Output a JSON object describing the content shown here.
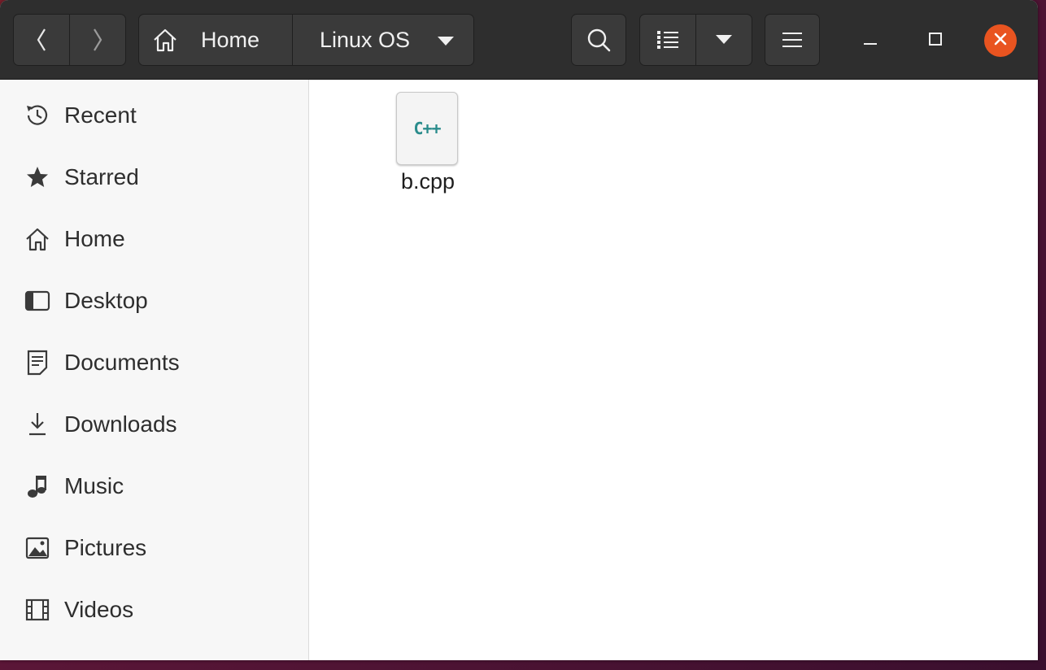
{
  "headerbar": {
    "breadcrumb": {
      "home_label": "Home",
      "current_label": "Linux OS"
    },
    "icons": {
      "back": "chevron-left-icon",
      "forward": "chevron-right-icon",
      "home": "home-icon",
      "search": "search-icon",
      "list_view": "list-view-icon",
      "view_menu": "chevron-down-icon",
      "main_menu": "hamburger-menu-icon",
      "minimize": "minimize-icon",
      "maximize": "maximize-icon",
      "close": "close-icon"
    }
  },
  "sidebar": {
    "items": [
      {
        "label": "Recent",
        "icon": "clock-icon"
      },
      {
        "label": "Starred",
        "icon": "star-icon"
      },
      {
        "label": "Home",
        "icon": "home-icon"
      },
      {
        "label": "Desktop",
        "icon": "desktop-icon"
      },
      {
        "label": "Documents",
        "icon": "document-icon"
      },
      {
        "label": "Downloads",
        "icon": "download-icon"
      },
      {
        "label": "Music",
        "icon": "music-note-icon"
      },
      {
        "label": "Pictures",
        "icon": "picture-icon"
      },
      {
        "label": "Videos",
        "icon": "film-icon"
      }
    ]
  },
  "content": {
    "files": [
      {
        "name": "b.cpp",
        "icon_text": "C++",
        "icon": "cpp-file-icon"
      }
    ]
  },
  "colors": {
    "headerbar_bg": "#2e2e2e",
    "button_bg": "#3a3a3a",
    "close_button": "#e95420",
    "sidebar_bg": "#f7f7f7",
    "cpp_icon_text": "#2a8c8c"
  }
}
